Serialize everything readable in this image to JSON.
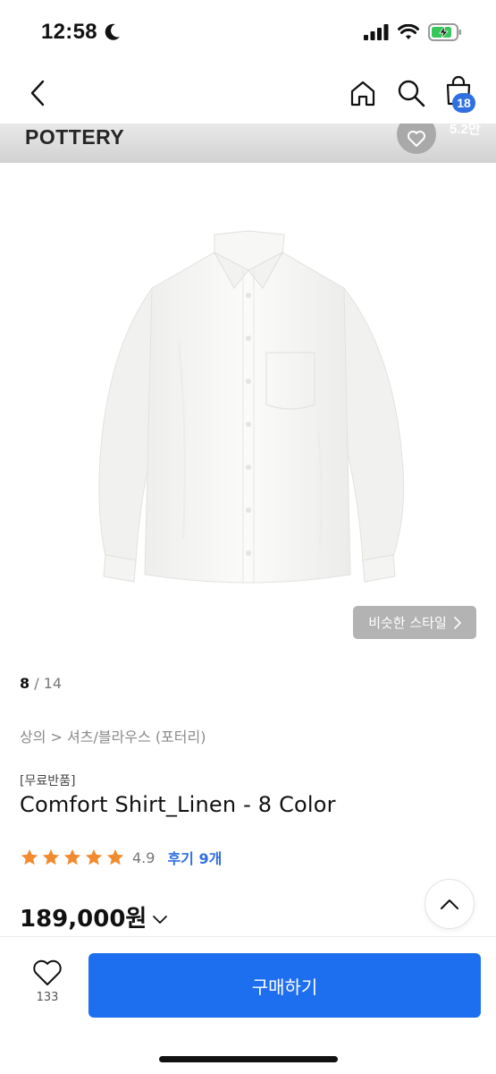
{
  "status_bar": {
    "time": "12:58"
  },
  "nav": {
    "cart_count": "18"
  },
  "brand": {
    "name": "POTTERY",
    "like_count": "5.2만"
  },
  "gallery": {
    "similar_style_label": "비슷한 스타일",
    "current": "8",
    "separator": "/",
    "total": "14"
  },
  "breadcrumb": "상의 > 셔츠/블라우스 (포터리)",
  "product": {
    "tag": "[무료반품]",
    "title": "Comfort Shirt_Linen - 8 Color",
    "rating": "4.9",
    "stars": 5,
    "review_label": "후기 9개",
    "price": "189,000원"
  },
  "bottom_bar": {
    "wish_count": "133",
    "buy_label": "구매하기"
  },
  "colors": {
    "accent": "#1e6ff0",
    "badge": "#2f6fe0",
    "star": "#f28b30"
  },
  "icons": [
    "back-chevron-icon",
    "home-icon",
    "search-icon",
    "shopping-bag-icon",
    "heart-icon",
    "chevron-right-icon",
    "chevron-down-icon",
    "chevron-up-icon",
    "star-icon",
    "moon-icon",
    "signal-icon",
    "wifi-icon",
    "battery-icon"
  ]
}
